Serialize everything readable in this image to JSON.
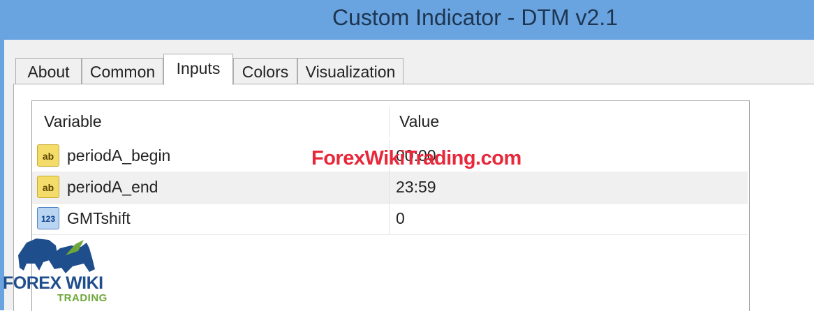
{
  "window": {
    "title": "Custom Indicator - DTM v2.1"
  },
  "tabs": [
    {
      "label": "About"
    },
    {
      "label": "Common"
    },
    {
      "label": "Inputs"
    },
    {
      "label": "Colors"
    },
    {
      "label": "Visualization"
    }
  ],
  "active_tab": "Inputs",
  "table": {
    "headers": {
      "variable": "Variable",
      "value": "Value"
    },
    "rows": [
      {
        "icon": "ab",
        "name": "periodA_begin",
        "value": "00:00"
      },
      {
        "icon": "ab",
        "name": "periodA_end",
        "value": "23:59"
      },
      {
        "icon": "123",
        "name": "GMTshift",
        "value": "0"
      }
    ]
  },
  "watermark": {
    "text": "ForexWikiTrading.com",
    "color": "#e8283a"
  },
  "logo": {
    "word": "FOREX WIKI",
    "sub": "TRADING"
  },
  "colors": {
    "titlebar": "#6aa4e0",
    "title_text": "#1d3550"
  }
}
